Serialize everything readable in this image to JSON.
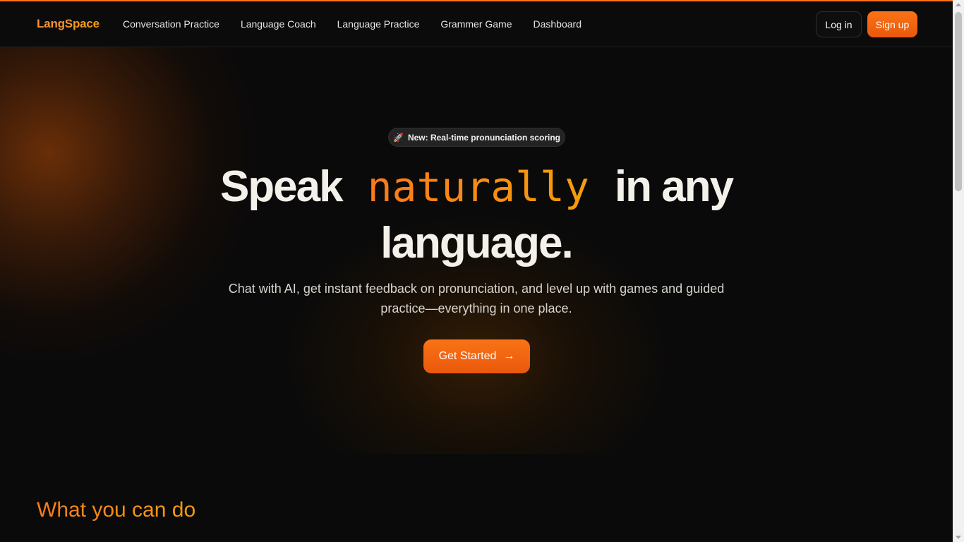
{
  "brand": {
    "name": "LangSpace",
    "accent_color": "#f97316"
  },
  "nav": {
    "items": [
      {
        "label": "Conversation Practice"
      },
      {
        "label": "Language Coach"
      },
      {
        "label": "Language Practice"
      },
      {
        "label": "Grammer Game"
      },
      {
        "label": "Dashboard"
      }
    ],
    "login_label": "Log in",
    "signup_label": "Sign up"
  },
  "hero": {
    "badge_icon": "🚀",
    "badge_text": "New: Real-time pronunciation scoring",
    "headline_start": "Speak",
    "headline_accent": "naturally",
    "headline_mid": "in any",
    "headline_end": "language.",
    "subtitle_line1": "Chat with AI, get instant feedback on pronunciation, and level up with games and guided",
    "subtitle_line2": "practice—everything in one place.",
    "cta_label": "Get Started",
    "cta_icon": "→"
  },
  "features": {
    "title": "What you can do"
  }
}
